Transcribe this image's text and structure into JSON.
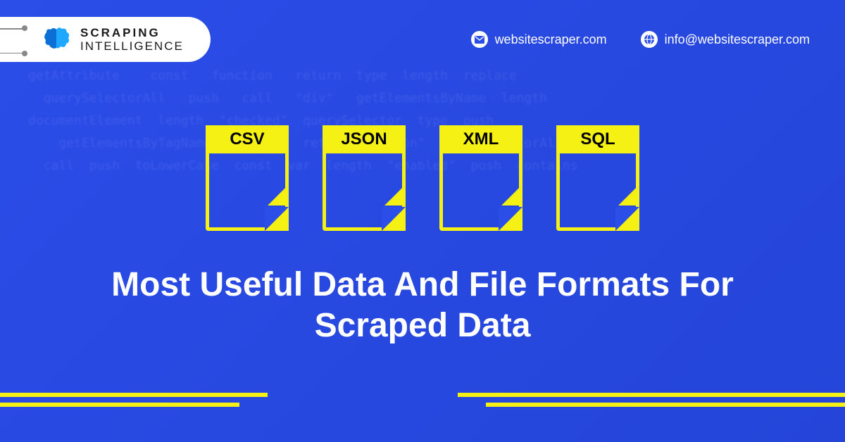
{
  "brand": {
    "line1": "SCRAPING",
    "line2": "INTELLIGENCE"
  },
  "contacts": {
    "website": "websitescraper.com",
    "email": "info@websitescraper.com"
  },
  "file_formats": [
    "CSV",
    "JSON",
    "XML",
    "SQL"
  ],
  "headline": "Most Useful Data And File Formats For Scraped Data",
  "colors": {
    "bg": "#2b4de8",
    "accent": "#f5f115"
  }
}
